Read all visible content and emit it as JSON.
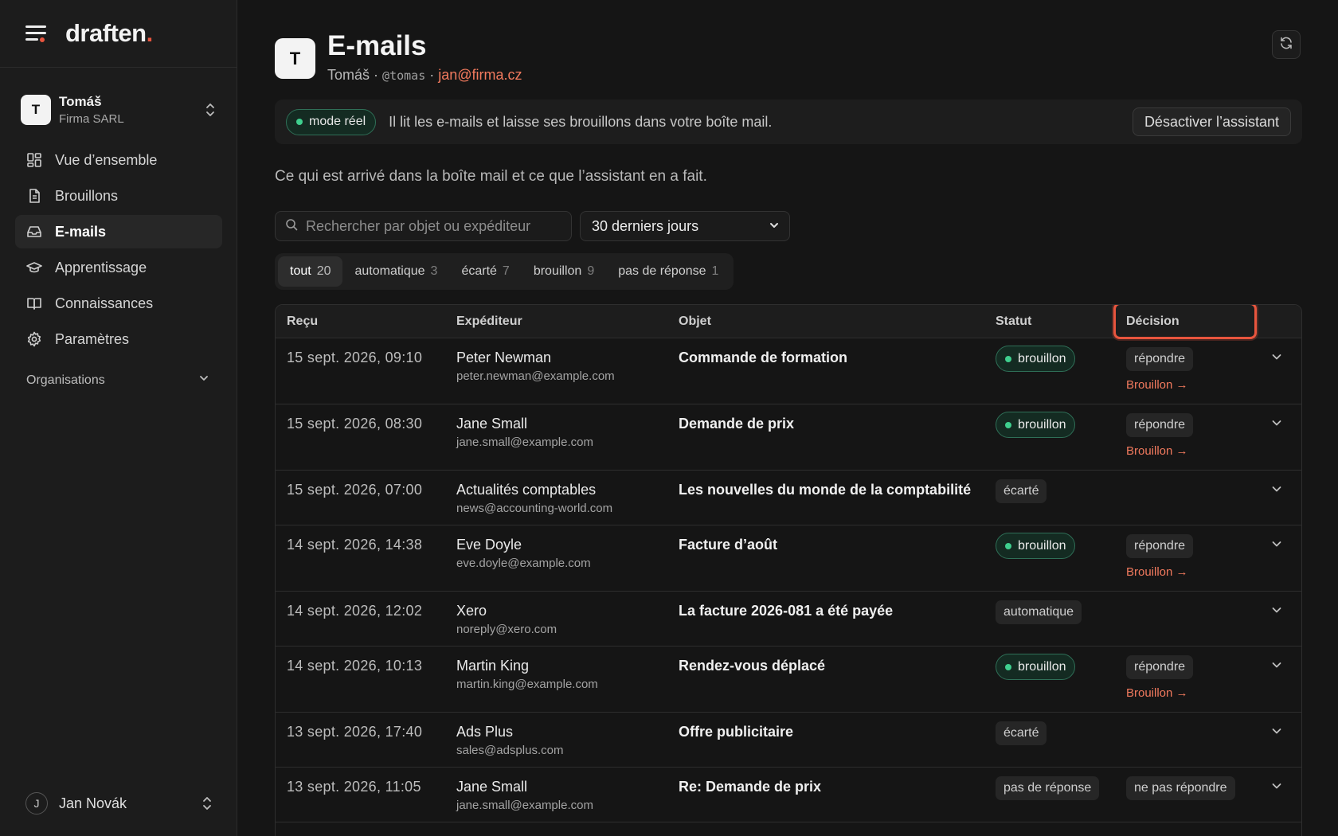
{
  "brand": {
    "name": "draften",
    "dot": "."
  },
  "account": {
    "initial": "T",
    "name": "Tomáš",
    "org": "Firma SARL"
  },
  "nav": [
    {
      "label": "Vue d’ensemble",
      "icon": "dashboard-icon"
    },
    {
      "label": "Brouillons",
      "icon": "document-icon"
    },
    {
      "label": "E-mails",
      "icon": "inbox-icon",
      "active": true
    },
    {
      "label": "Apprentissage",
      "icon": "graduation-cap-icon"
    },
    {
      "label": "Connaissances",
      "icon": "book-icon"
    },
    {
      "label": "Paramètres",
      "icon": "gear-icon"
    }
  ],
  "organisations_label": "Organisations",
  "user": {
    "initial": "J",
    "name": "Jan Novák"
  },
  "header": {
    "initial": "T",
    "title": "E-mails",
    "sub_name": "Tomáš",
    "sep": "·",
    "handle": "@tomas",
    "email": "jan@firma.cz"
  },
  "banner": {
    "mode": "mode réel",
    "text": "Il lit les e-mails et laisse ses brouillons dans votre boîte mail.",
    "button": "Désactiver l’assistant"
  },
  "intro": "Ce qui est arrivé dans la boîte mail et ce que l’assistant en a fait.",
  "search": {
    "placeholder": "Rechercher par objet ou expéditeur"
  },
  "period": {
    "value": "30 derniers jours"
  },
  "filters": [
    {
      "label": "tout",
      "count": "20",
      "active": true
    },
    {
      "label": "automatique",
      "count": "3"
    },
    {
      "label": "écarté",
      "count": "7"
    },
    {
      "label": "brouillon",
      "count": "9"
    },
    {
      "label": "pas de réponse",
      "count": "1"
    }
  ],
  "columns": {
    "received": "Reçu",
    "sender": "Expéditeur",
    "subject": "Objet",
    "status": "Statut",
    "decision": "Décision"
  },
  "rows": [
    {
      "date": "15 sept. 2026, 09:10",
      "name": "Peter Newman",
      "email": "peter.newman@example.com",
      "subject": "Commande de formation",
      "status": "brouillon",
      "status_kind": "green",
      "decision": "répondre",
      "link": "Brouillon →"
    },
    {
      "date": "15 sept. 2026, 08:30",
      "name": "Jane Small",
      "email": "jane.small@example.com",
      "subject": "Demande de prix",
      "status": "brouillon",
      "status_kind": "green",
      "decision": "répondre",
      "link": "Brouillon →"
    },
    {
      "date": "15 sept. 2026, 07:00",
      "name": "Actualités comptables",
      "email": "news@accounting-world.com",
      "subject": "Les nouvelles du monde de la comptabilité",
      "status": "écarté",
      "status_kind": "neutral",
      "decision": "",
      "link": ""
    },
    {
      "date": "14 sept. 2026, 14:38",
      "name": "Eve Doyle",
      "email": "eve.doyle@example.com",
      "subject": "Facture d’août",
      "status": "brouillon",
      "status_kind": "green",
      "decision": "répondre",
      "link": "Brouillon →"
    },
    {
      "date": "14 sept. 2026, 12:02",
      "name": "Xero",
      "email": "noreply@xero.com",
      "subject": "La facture 2026-081 a été payée",
      "status": "automatique",
      "status_kind": "neutral",
      "decision": "",
      "link": ""
    },
    {
      "date": "14 sept. 2026, 10:13",
      "name": "Martin King",
      "email": "martin.king@example.com",
      "subject": "Rendez-vous déplacé",
      "status": "brouillon",
      "status_kind": "green",
      "decision": "répondre",
      "link": "Brouillon →"
    },
    {
      "date": "13 sept. 2026, 17:40",
      "name": "Ads Plus",
      "email": "sales@adsplus.com",
      "subject": "Offre publicitaire",
      "status": "écarté",
      "status_kind": "neutral",
      "decision": "",
      "link": ""
    },
    {
      "date": "13 sept. 2026, 11:05",
      "name": "Jane Small",
      "email": "jane.small@example.com",
      "subject": "Re: Demande de prix",
      "status": "pas de réponse",
      "status_kind": "neutral",
      "decision": "ne pas répondre",
      "link": ""
    }
  ],
  "colors": {
    "accent": "#e8553e",
    "link": "#f27a5e",
    "green": "#3fcf8e"
  }
}
